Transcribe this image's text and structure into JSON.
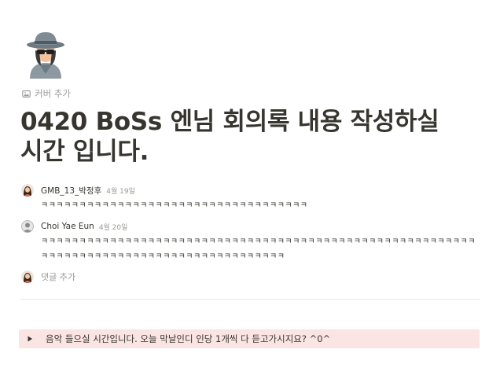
{
  "page": {
    "icon": "spy-detective-icon",
    "add_cover_label": "커버 추가",
    "title": "0420 BoSs 엔님 회의록 내용 작성하실 시간 입니다."
  },
  "comments": [
    {
      "author": "GMB_13_박정후",
      "time": "4월 19일",
      "text": "ㅋㅋㅋㅋㅋㅋㅋㅋㅋㅋㅋㅋㅋㅋㅋㅋㅋㅋㅋㅋㅋㅋㅋㅋㅋㅋㅋㅋㅋㅋㅋㅋㅋㅋㅋ",
      "avatar": "woman-avatar-icon"
    },
    {
      "author": "Choi Yae Eun",
      "time": "4월 20일",
      "text": "ㅋㅋㅋㅋㅋㅋㅋㅋㅋㅋㅋㅋㅋㅋㅋㅋㅋㅋㅋㅋㅋㅋㅋㅋㅋㅋㅋㅋㅋㅋㅋㅋㅋㅋㅋㅋㅋㅋㅋㅋㅋㅋㅋㅋㅋㅋㅋㅋㅋㅋㅋㅋㅋㅋㅋㅋㅋㅋㅋㅋㅋㅋㅋㅋㅋㅋㅋㅋㅋㅋㅋㅋㅋㅋㅋㅋㅋㅋㅋㅋㅋㅋㅋㅋㅋㅋㅋㅋㅋ",
      "avatar": "user-avatar-icon"
    }
  ],
  "add_comment": {
    "placeholder": "댓글 추가"
  },
  "toggle": {
    "text": "음악 들으실 시간입니다. 오늘 막날인디 인당 1개씩 다 듣고가시지요? ^0^",
    "background": "#fbe4e4"
  }
}
